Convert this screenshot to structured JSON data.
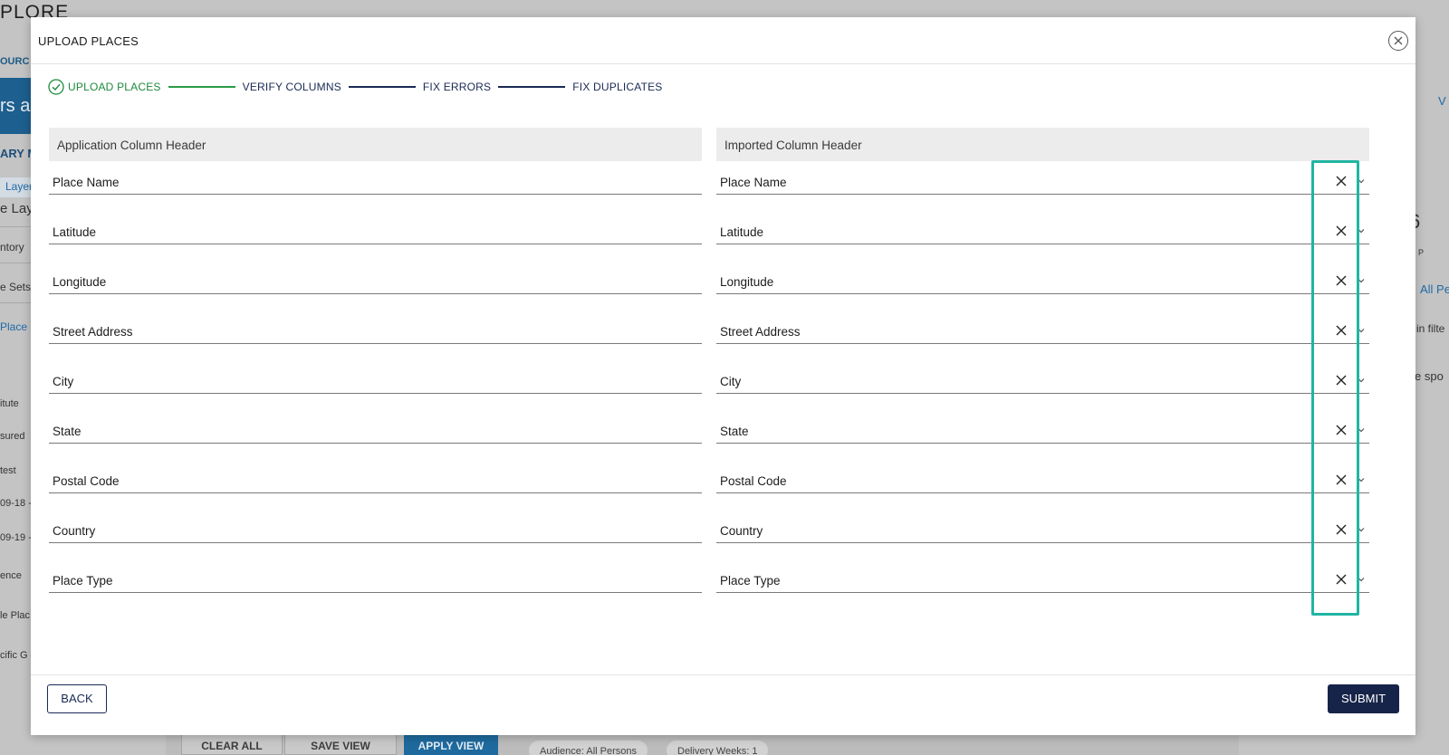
{
  "background": {
    "app_title": "PLORE",
    "source_label": "OURC",
    "banner_text": "rs ai",
    "summary_label": "ARY M",
    "layers_tab": "Layer",
    "left_items": [
      "e Lay",
      "ntory",
      "e Sets",
      "Place S",
      "itute",
      "sured",
      "test",
      "09-18 -",
      "09-19 -",
      "ence",
      "le Plac",
      "cific G"
    ],
    "right_items": [
      "V",
      "6",
      "P",
      "All Pe",
      "in filte",
      "e spo"
    ],
    "buttons": {
      "clear_all": "CLEAR ALL",
      "save_view": "SAVE VIEW",
      "apply_view": "APPLY VIEW"
    },
    "chips": [
      "Audience: All Persons",
      "Delivery Weeks: 1"
    ]
  },
  "modal": {
    "title": "UPLOAD PLACES",
    "steps": [
      {
        "label": "UPLOAD PLACES",
        "state": "done"
      },
      {
        "label": "VERIFY COLUMNS",
        "state": "current"
      },
      {
        "label": "FIX ERRORS",
        "state": "todo"
      },
      {
        "label": "FIX DUPLICATES",
        "state": "todo"
      }
    ],
    "left_header": "Application Column Header",
    "right_header": "Imported Column Header",
    "rows": [
      {
        "app": "Place Name",
        "imported": "Place Name"
      },
      {
        "app": "Latitude",
        "imported": "Latitude"
      },
      {
        "app": "Longitude",
        "imported": "Longitude"
      },
      {
        "app": "Street Address",
        "imported": "Street Address"
      },
      {
        "app": "City",
        "imported": "City"
      },
      {
        "app": "State",
        "imported": "State"
      },
      {
        "app": "Postal Code",
        "imported": "Postal Code"
      },
      {
        "app": "Country",
        "imported": "Country"
      },
      {
        "app": "Place Type",
        "imported": "Place Type"
      }
    ],
    "back_label": "BACK",
    "submit_label": "SUBMIT"
  },
  "colors": {
    "step_done": "#1e8a3c",
    "step_todo": "#1a2a55",
    "submit_bg": "#172449",
    "highlight": "#20b5a3"
  }
}
